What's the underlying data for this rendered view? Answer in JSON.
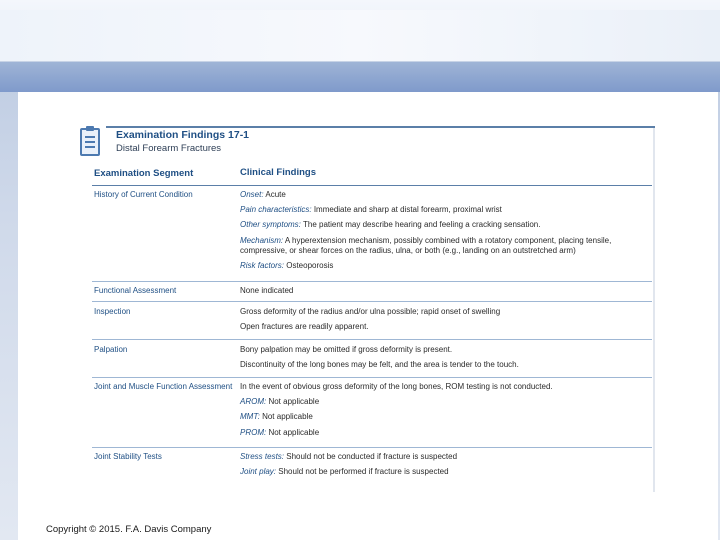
{
  "document": {
    "title": "Examination Findings 17-1",
    "subtitle": "Distal Forearm Fractures",
    "columns": [
      "Examination Segment",
      "Clinical Findings"
    ],
    "rows": [
      {
        "segment": "History of Current Condition",
        "lines": [
          {
            "label": "Onset:",
            "text": " Acute"
          },
          {
            "label": "Pain characteristics:",
            "text": " Immediate and sharp at distal forearm, proximal wrist"
          },
          {
            "label": "Other symptoms:",
            "text": " The patient may describe hearing and feeling a cracking sensation."
          },
          {
            "label": "Mechanism:",
            "text": " A hyperextension mechanism, possibly combined with a rotatory component, placing tensile, compressive, or shear forces on the radius, ulna, or both (e.g., landing on an outstretched arm)"
          },
          {
            "label": "Risk factors:",
            "text": " Osteoporosis"
          }
        ]
      },
      {
        "segment": "Functional Assessment",
        "lines": [
          {
            "label": "",
            "text": "None indicated"
          }
        ]
      },
      {
        "segment": "Inspection",
        "lines": [
          {
            "label": "",
            "text": "Gross deformity of the radius and/or ulna possible; rapid onset of swelling"
          },
          {
            "label": "",
            "text": "Open fractures are readily apparent."
          }
        ]
      },
      {
        "segment": "Palpation",
        "lines": [
          {
            "label": "",
            "text": "Bony palpation may be omitted if gross deformity is present."
          },
          {
            "label": "",
            "text": "Discontinuity of the long bones may be felt, and the area is tender to the touch."
          }
        ]
      },
      {
        "segment": "Joint and Muscle Function Assessment",
        "lines": [
          {
            "label": "",
            "text": "In the event of obvious gross deformity of the long bones, ROM testing is not conducted."
          },
          {
            "label": "AROM:",
            "text": " Not applicable"
          },
          {
            "label": "MMT:",
            "text": " Not applicable"
          },
          {
            "label": "PROM:",
            "text": " Not applicable"
          }
        ]
      },
      {
        "segment": "Joint Stability Tests",
        "lines": [
          {
            "label": "Stress tests:",
            "text": " Should not be conducted if fracture is suspected"
          },
          {
            "label": "Joint play:",
            "text": " Should not be performed if fracture is suspected"
          }
        ]
      }
    ]
  },
  "footer": {
    "copyright": "Copyright © 2015. F.A. Davis Company"
  },
  "icons": {
    "header_icon": "clipboard-icon"
  }
}
